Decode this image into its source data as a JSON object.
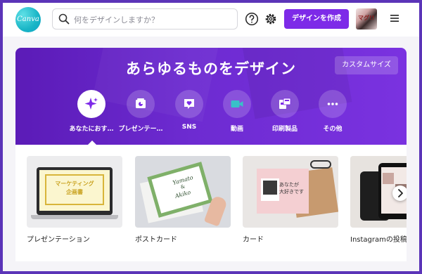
{
  "header": {
    "logo_text": "Canva",
    "search_placeholder": "何をデザインしますか？",
    "create_button": "デザインを作成",
    "avatar_text": "マグ!!"
  },
  "hero": {
    "title": "あらゆるものをデザイン",
    "custom_size_button": "カスタムサイズ",
    "categories": [
      {
        "label": "あなたにおす…",
        "icon": "sparkle-icon",
        "active": true
      },
      {
        "label": "プレゼンテー…",
        "icon": "presentation-icon",
        "active": false
      },
      {
        "label": "SNS",
        "icon": "heart-icon",
        "active": false
      },
      {
        "label": "動画",
        "icon": "video-icon",
        "active": false
      },
      {
        "label": "印刷製品",
        "icon": "print-icon",
        "active": false
      },
      {
        "label": "その他",
        "icon": "more-icon",
        "active": false
      }
    ]
  },
  "cards": [
    {
      "caption": "プレゼンテーション",
      "thumb_line1": "マーケティング",
      "thumb_line2": "企画書"
    },
    {
      "caption": "ポストカード",
      "thumb_line1": "Yamato",
      "thumb_line2": "&",
      "thumb_line3": "Akiko"
    },
    {
      "caption": "カード",
      "thumb_line1": "あなたが",
      "thumb_line2": "大好きです"
    },
    {
      "caption": "Instagramの投稿"
    }
  ],
  "colors": {
    "accent": "#7d2ae8",
    "hero": "#6d2bd1",
    "logo": "#19b5c6"
  }
}
